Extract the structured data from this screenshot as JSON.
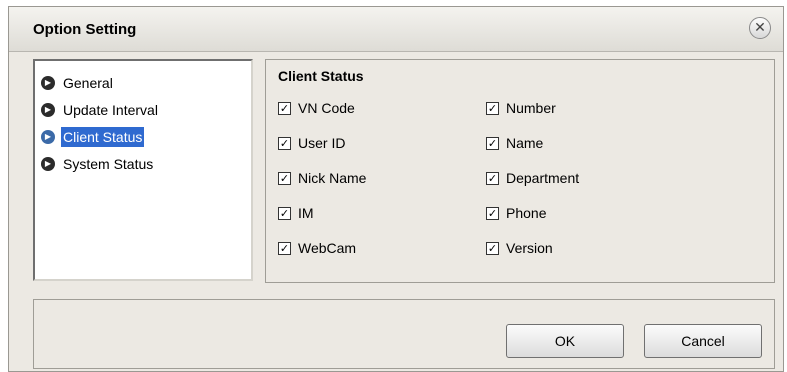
{
  "window": {
    "title": "Option Setting"
  },
  "tree": {
    "items": [
      {
        "label": "General",
        "selected": false
      },
      {
        "label": "Update Interval",
        "selected": false
      },
      {
        "label": "Client Status",
        "selected": true
      },
      {
        "label": "System Status",
        "selected": false
      }
    ]
  },
  "group": {
    "title": "Client Status",
    "left_column": [
      {
        "label": "VN Code",
        "checked": true
      },
      {
        "label": "User ID",
        "checked": true
      },
      {
        "label": "Nick Name",
        "checked": true
      },
      {
        "label": "IM",
        "checked": true
      },
      {
        "label": "WebCam",
        "checked": true
      }
    ],
    "right_column": [
      {
        "label": "Number",
        "checked": true
      },
      {
        "label": "Name",
        "checked": true
      },
      {
        "label": "Department",
        "checked": true
      },
      {
        "label": "Phone",
        "checked": true
      },
      {
        "label": "Version",
        "checked": true
      }
    ]
  },
  "buttons": {
    "ok": "OK",
    "cancel": "Cancel"
  },
  "icons": {
    "close": "close-icon",
    "bullet": "arrow-bullet-icon",
    "check": "checkmark-icon"
  }
}
